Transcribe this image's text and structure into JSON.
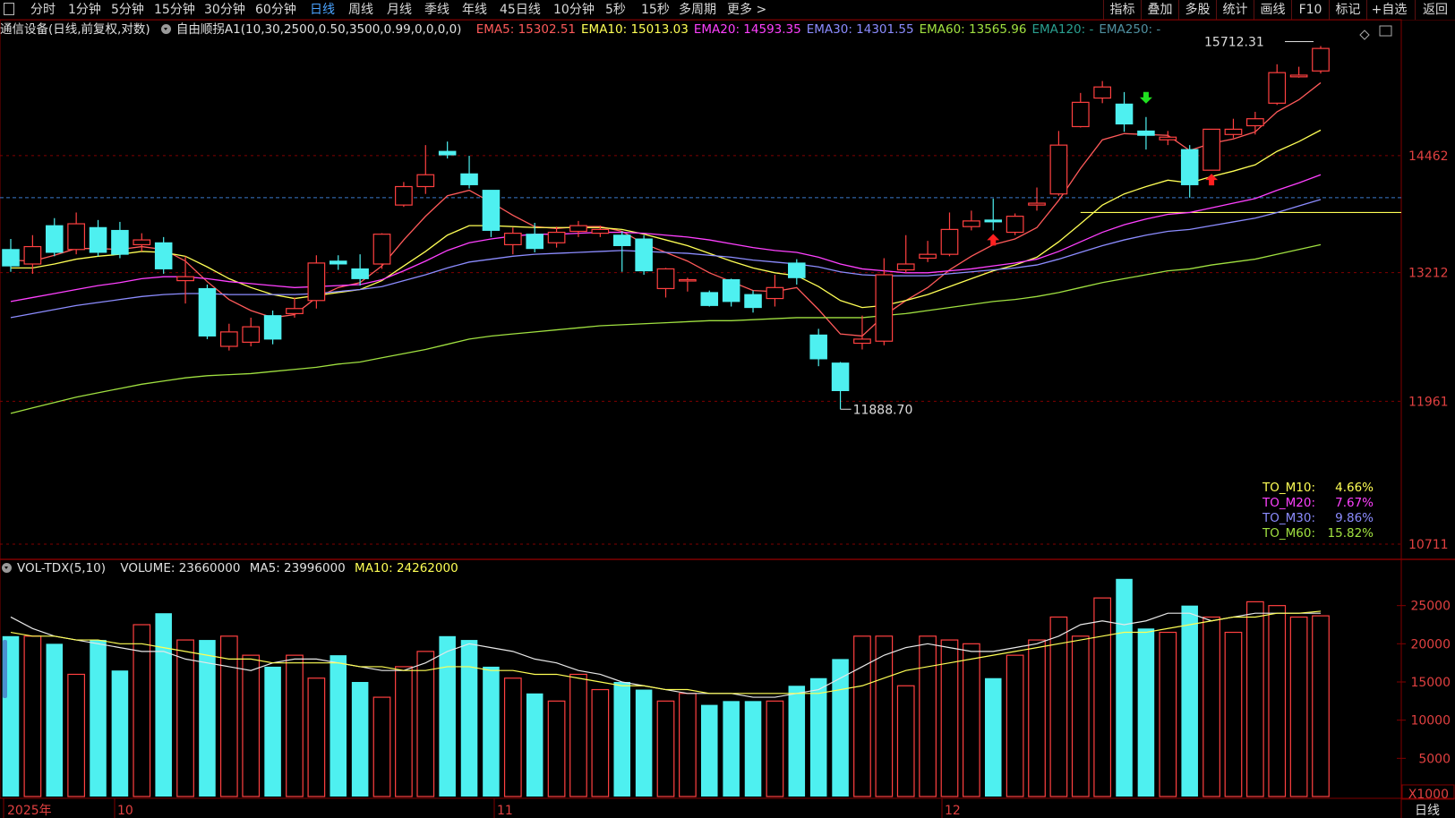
{
  "toolbar": {
    "left": [
      "分时",
      "1分钟",
      "5分钟",
      "15分钟",
      "30分钟",
      "60分钟",
      "日线",
      "周线",
      "月线",
      "季线",
      "年线",
      "45日线",
      "10分钟",
      "5秒",
      "15秒",
      "多周期",
      "更多 >"
    ],
    "active": "日线",
    "right": [
      "指标",
      "叠加",
      "多股",
      "统计",
      "画线",
      "F10",
      "标记",
      "+自选",
      "返回"
    ]
  },
  "info": {
    "title": "通信设备(日线,前复权,对数)",
    "indicator": "自由顺拐A1(10,30,2500,0.50,3500,0.99,0,0,0,0)",
    "ema": [
      {
        "label": "EMA5: 15302.51",
        "color": "#ff5a5a"
      },
      {
        "label": "EMA10: 15013.03",
        "color": "#ffff55"
      },
      {
        "label": "EMA20: 14593.35",
        "color": "#ff40ff"
      },
      {
        "label": "EMA30: 14301.55",
        "color": "#8c8cff"
      },
      {
        "label": "EMA60: 13565.96",
        "color": "#a0e040"
      },
      {
        "label": "EMA120: -",
        "color": "#2aa090"
      },
      {
        "label": "EMA250: -",
        "color": "#5090a0"
      }
    ]
  },
  "volume_info": {
    "name": "VOL-TDX(5,10)",
    "volume": "VOLUME: 23660000",
    "ma5": "MA5: 23996000",
    "ma10": "MA10: 24262000"
  },
  "price_axis": [
    "14462",
    "13212",
    "11961",
    "10711"
  ],
  "volume_axis": [
    "25000",
    "20000",
    "15000",
    "10000",
    "5000"
  ],
  "volume_unit": "X1000",
  "date_labels": [
    "2025年",
    "10",
    "11",
    "12"
  ],
  "period_label": "日线",
  "annotations": {
    "high": "15712.31",
    "low": "11888.70"
  },
  "to_indicators": [
    {
      "label": "TO_M10:",
      "value": "4.66%",
      "color": "#ffff55"
    },
    {
      "label": "TO_M20:",
      "value": "7.67%",
      "color": "#ff40ff"
    },
    {
      "label": "TO_M30:",
      "value": "9.86%",
      "color": "#8c8cff"
    },
    {
      "label": "TO_M60:",
      "value": "15.82%",
      "color": "#a0e040"
    }
  ],
  "colors": {
    "up": "#ff4040",
    "down": "#4ef0f0",
    "grid": "#800000",
    "ref": "#3a7acc"
  },
  "chart_data": {
    "type": "candlestick",
    "price_scale": "log",
    "candles": [
      [
        13450,
        13280,
        13560,
        13220
      ],
      [
        13300,
        13480,
        13600,
        13200
      ],
      [
        13700,
        13420,
        13780,
        13380
      ],
      [
        13450,
        13720,
        13840,
        13400
      ],
      [
        13680,
        13420,
        13760,
        13380
      ],
      [
        13650,
        13400,
        13740,
        13360
      ],
      [
        13500,
        13550,
        13620,
        13430
      ],
      [
        13520,
        13250,
        13580,
        13200
      ],
      [
        13130,
        13170,
        13380,
        12900
      ],
      [
        13050,
        12580,
        13090,
        12550
      ],
      [
        12480,
        12620,
        12700,
        12440
      ],
      [
        12520,
        12670,
        12760,
        12480
      ],
      [
        12780,
        12550,
        12830,
        12500
      ],
      [
        12800,
        12850,
        12960,
        12760
      ],
      [
        12930,
        13310,
        13390,
        12850
      ],
      [
        13330,
        13300,
        13390,
        13240
      ],
      [
        13250,
        13150,
        13400,
        13080
      ],
      [
        13300,
        13610,
        13620,
        13250
      ],
      [
        13920,
        14120,
        14170,
        13900
      ],
      [
        14120,
        14250,
        14580,
        14040
      ],
      [
        14510,
        14470,
        14620,
        14430
      ],
      [
        14260,
        14140,
        14460,
        14100
      ],
      [
        14080,
        13650,
        14080,
        13580
      ],
      [
        13500,
        13620,
        13680,
        13400
      ],
      [
        13610,
        13460,
        13730,
        13420
      ],
      [
        13520,
        13630,
        13690,
        13470
      ],
      [
        13640,
        13700,
        13750,
        13580
      ],
      [
        13620,
        13660,
        13700,
        13580
      ],
      [
        13600,
        13490,
        13640,
        13220
      ],
      [
        13560,
        13230,
        13600,
        13190
      ],
      [
        13050,
        13250,
        13260,
        12960
      ],
      [
        13140,
        13140,
        13160,
        13020
      ],
      [
        13010,
        12880,
        13030,
        12870
      ],
      [
        13140,
        12920,
        13150,
        12870
      ],
      [
        12990,
        12860,
        13030,
        12810
      ],
      [
        12950,
        13060,
        13190,
        12870
      ],
      [
        13310,
        13160,
        13350,
        13090
      ],
      [
        12590,
        12360,
        12650,
        12290
      ],
      [
        12320,
        12060,
        12330,
        11888
      ],
      [
        12510,
        12550,
        12780,
        12450
      ],
      [
        12530,
        13190,
        13360,
        12490
      ],
      [
        13240,
        13300,
        13600,
        13210
      ],
      [
        13360,
        13400,
        13540,
        13320
      ],
      [
        13400,
        13660,
        13840,
        13380
      ],
      [
        13690,
        13750,
        13860,
        13650
      ],
      [
        13760,
        13740,
        13990,
        13650
      ],
      [
        13630,
        13800,
        13830,
        13600
      ],
      [
        13920,
        13940,
        14110,
        13860
      ],
      [
        14040,
        14580,
        14740,
        14020
      ],
      [
        14790,
        15070,
        15180,
        14780
      ],
      [
        15120,
        15250,
        15320,
        15060
      ],
      [
        15050,
        14820,
        15190,
        14730
      ],
      [
        14740,
        14690,
        14900,
        14530
      ],
      [
        14640,
        14670,
        14740,
        14580
      ],
      [
        14530,
        14140,
        14580,
        14000
      ],
      [
        14300,
        14760,
        14760,
        14300
      ],
      [
        14700,
        14760,
        14880,
        14660
      ],
      [
        14800,
        14880,
        14960,
        14700
      ],
      [
        15060,
        15420,
        15520,
        15040
      ],
      [
        15370,
        15390,
        15490,
        15360
      ],
      [
        15440,
        15711,
        15740,
        15410
      ]
    ],
    "ema_lines": {
      "EMA5": [
        13340,
        13330,
        13390,
        13460,
        13460,
        13450,
        13480,
        13450,
        13330,
        13120,
        12940,
        12830,
        12760,
        12790,
        12960,
        13060,
        13110,
        13280,
        13550,
        13800,
        14020,
        14080,
        13950,
        13810,
        13690,
        13670,
        13690,
        13690,
        13640,
        13510,
        13420,
        13330,
        13210,
        13120,
        13030,
        13020,
        13060,
        12840,
        12600,
        12580,
        12780,
        12930,
        13060,
        13240,
        13380,
        13500,
        13560,
        13680,
        13970,
        14320,
        14640,
        14710,
        14700,
        14690,
        14520,
        14600,
        14650,
        14730,
        14960,
        15100,
        15300
      ],
      "EMA10": [
        13260,
        13260,
        13300,
        13350,
        13380,
        13400,
        13430,
        13420,
        13380,
        13270,
        13150,
        13060,
        12990,
        12950,
        12980,
        13010,
        13040,
        13130,
        13280,
        13430,
        13600,
        13700,
        13700,
        13690,
        13680,
        13680,
        13680,
        13680,
        13660,
        13610,
        13550,
        13490,
        13410,
        13330,
        13260,
        13210,
        13180,
        13070,
        12930,
        12860,
        12880,
        12930,
        12990,
        13070,
        13150,
        13230,
        13290,
        13370,
        13530,
        13720,
        13920,
        14040,
        14120,
        14190,
        14160,
        14230,
        14290,
        14360,
        14510,
        14620,
        14750
      ],
      "EMA20": [
        12920,
        12960,
        13000,
        13040,
        13080,
        13110,
        13150,
        13170,
        13170,
        13150,
        13120,
        13100,
        13080,
        13060,
        13070,
        13080,
        13090,
        13140,
        13230,
        13330,
        13440,
        13520,
        13560,
        13590,
        13610,
        13610,
        13620,
        13630,
        13630,
        13620,
        13600,
        13580,
        13550,
        13510,
        13470,
        13440,
        13420,
        13370,
        13300,
        13250,
        13230,
        13210,
        13210,
        13230,
        13250,
        13280,
        13310,
        13350,
        13430,
        13530,
        13630,
        13710,
        13770,
        13820,
        13840,
        13890,
        13940,
        13990,
        14080,
        14160,
        14250
      ],
      "EMA30": [
        12760,
        12800,
        12840,
        12880,
        12910,
        12940,
        12970,
        12990,
        13000,
        13000,
        12990,
        12990,
        12990,
        12990,
        13000,
        13020,
        13040,
        13070,
        13130,
        13190,
        13260,
        13320,
        13350,
        13380,
        13400,
        13410,
        13420,
        13430,
        13440,
        13430,
        13420,
        13410,
        13390,
        13370,
        13340,
        13320,
        13300,
        13270,
        13220,
        13190,
        13180,
        13180,
        13180,
        13200,
        13220,
        13240,
        13260,
        13290,
        13350,
        13420,
        13490,
        13550,
        13600,
        13640,
        13660,
        13700,
        13740,
        13780,
        13840,
        13910,
        13980
      ],
      "EMA60": [
        11850,
        11900,
        11950,
        12000,
        12040,
        12080,
        12120,
        12150,
        12180,
        12200,
        12210,
        12220,
        12240,
        12260,
        12280,
        12310,
        12330,
        12370,
        12410,
        12450,
        12500,
        12550,
        12580,
        12600,
        12620,
        12640,
        12660,
        12680,
        12690,
        12700,
        12710,
        12720,
        12730,
        12730,
        12740,
        12750,
        12760,
        12760,
        12760,
        12760,
        12780,
        12800,
        12830,
        12860,
        12890,
        12920,
        12940,
        12970,
        13010,
        13060,
        13110,
        13150,
        13190,
        13230,
        13250,
        13290,
        13320,
        13350,
        13400,
        13450,
        13500
      ]
    },
    "volume": [
      21000,
      21000,
      20000,
      16000,
      20500,
      16500,
      22500,
      24000,
      20500,
      20500,
      21000,
      18500,
      17000,
      18500,
      15500,
      18500,
      15000,
      13000,
      17000,
      19000,
      21000,
      20500,
      17000,
      15500,
      13500,
      12500,
      16000,
      14000,
      15000,
      14000,
      12500,
      13500,
      12000,
      12500,
      12500,
      12500,
      14500,
      15500,
      18000,
      21000,
      21000,
      14500,
      21000,
      20500,
      20000,
      15500,
      18500,
      20500,
      23500,
      21000,
      26000,
      28500,
      22000,
      21500,
      25000,
      23500,
      21500,
      25500,
      25000,
      23500,
      23660
    ],
    "vol_ma5": [
      23500,
      22000,
      21000,
      20500,
      20000,
      19500,
      19000,
      19000,
      18000,
      17500,
      17000,
      16500,
      17500,
      18000,
      18000,
      17500,
      17000,
      16500,
      16500,
      17500,
      19000,
      20000,
      19500,
      19000,
      18000,
      17500,
      16500,
      16000,
      15000,
      14500,
      14000,
      13500,
      13500,
      13500,
      13000,
      13000,
      13500,
      14000,
      15500,
      17000,
      18500,
      19500,
      20000,
      19500,
      19000,
      19000,
      19500,
      20000,
      21000,
      22500,
      23000,
      22500,
      23000,
      24000,
      24000,
      23000,
      23500,
      24000,
      24000,
      24000,
      24000
    ],
    "vol_ma10": [
      21500,
      21000,
      21000,
      20500,
      20500,
      20000,
      20000,
      19500,
      19000,
      18500,
      18000,
      18000,
      17500,
      17500,
      17500,
      17500,
      17000,
      17000,
      16500,
      16500,
      17000,
      17000,
      16500,
      16500,
      16000,
      16000,
      15500,
      15000,
      14500,
      14500,
      14000,
      14000,
      13500,
      13500,
      13500,
      13500,
      13500,
      13500,
      14000,
      14500,
      15500,
      16500,
      17000,
      17500,
      18000,
      18500,
      19000,
      19500,
      20000,
      20500,
      21000,
      21500,
      21500,
      22000,
      22500,
      23000,
      23500,
      23500,
      24000,
      24000,
      24262
    ],
    "arrows": [
      {
        "index": 52,
        "dir": "down",
        "color": "#20e020"
      },
      {
        "index": 45,
        "dir": "up",
        "color": "#ff2020"
      },
      {
        "index": 55,
        "dir": "up",
        "color": "#ff2020"
      }
    ],
    "ref_level": 14000,
    "yellow_level": 13840,
    "ylim": [
      10711,
      15712.31
    ],
    "vol_ylim": [
      0,
      30000
    ]
  }
}
